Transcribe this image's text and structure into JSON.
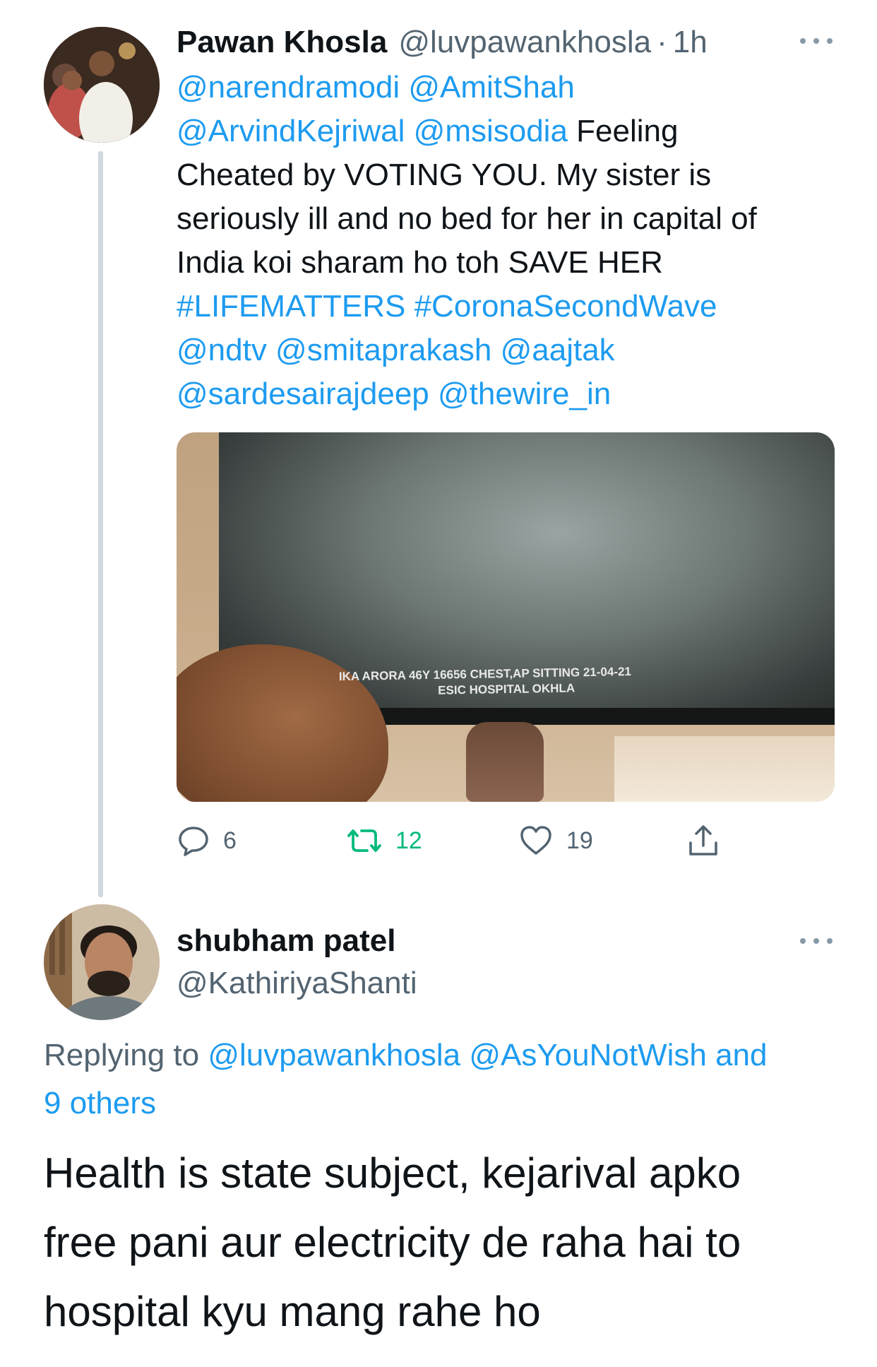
{
  "tweet": {
    "author_name": "Pawan Khosla",
    "author_handle": "@luvpawankhosla",
    "separator": "·",
    "time": "1h",
    "body_lines": [
      [
        {
          "t": "@narendramodi @AmitShah",
          "link": true
        }
      ],
      [
        {
          "t": "@ArvindKejriwal @msisodia",
          "link": true
        },
        {
          "t": " Feeling",
          "link": false
        }
      ],
      [
        {
          "t": "Cheated by VOTING YOU. My sister is",
          "link": false
        }
      ],
      [
        {
          "t": "seriously ill and no bed for her in capital of",
          "link": false
        }
      ],
      [
        {
          "t": "India koi sharam ho toh SAVE HER",
          "link": false
        }
      ],
      [
        {
          "t": "#LIFEMATTERS #CoronaSecondWave",
          "link": true
        }
      ],
      [
        {
          "t": "@ndtv @smitaprakash @aajtak",
          "link": true
        }
      ],
      [
        {
          "t": "@sardesairajdeep @thewire_in",
          "link": true
        }
      ]
    ],
    "media": {
      "label_line1": "IKA ARORA 46Y   16656      CHEST,AP SITTING   21-04-21",
      "label_line2": "ESIC HOSPITAL OKHLA"
    },
    "actions": {
      "replies": "6",
      "retweets": "12",
      "likes": "19"
    },
    "colors": {
      "link": "#1d9bf0",
      "retweet": "#00ba7c",
      "secondary": "#536471"
    }
  },
  "reply": {
    "author_name": "shubham patel",
    "author_handle": "@KathiriyaShanti",
    "replying_lines": [
      [
        {
          "t": "Replying to ",
          "link": false
        },
        {
          "t": "@luvpawankhosla @AsYouNotWish and",
          "link": true
        }
      ],
      [
        {
          "t": "9 others",
          "link": true
        }
      ]
    ],
    "text_lines": [
      "Health is state subject, kejarival apko",
      "free pani aur electricity de raha hai to",
      "hospital kyu mang rahe ho"
    ]
  }
}
